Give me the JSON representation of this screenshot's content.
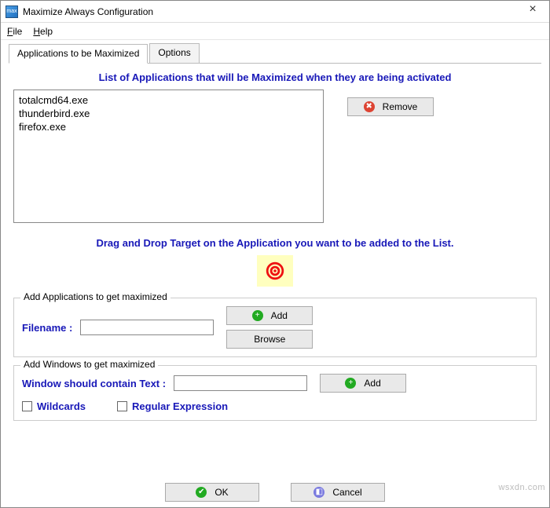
{
  "window": {
    "title": "Maximize Always Configuration",
    "icon": "max"
  },
  "menu": {
    "file": "File",
    "help": "Help"
  },
  "tabs": {
    "active": "Applications to be Maximized",
    "other": "Options"
  },
  "main": {
    "heading": "List of Applications that will be Maximized when they are being activated",
    "apps": [
      "totalcmd64.exe",
      "thunderbird.exe",
      "firefox.exe"
    ],
    "remove": "Remove",
    "drag_heading": "Drag and Drop Target on the Application you want to be added to the List."
  },
  "group_apps": {
    "legend": "Add Applications to get maximized",
    "filename_label": "Filename  :",
    "filename_value": "",
    "add": "Add",
    "browse": "Browse"
  },
  "group_windows": {
    "legend": "Add Windows to get maximized",
    "text_label": "Window should contain Text :",
    "text_value": "",
    "add": "Add",
    "wildcards": "Wildcards",
    "regex": "Regular Expression"
  },
  "buttons": {
    "ok": "OK",
    "cancel": "Cancel"
  },
  "watermark": "wsxdn.com"
}
